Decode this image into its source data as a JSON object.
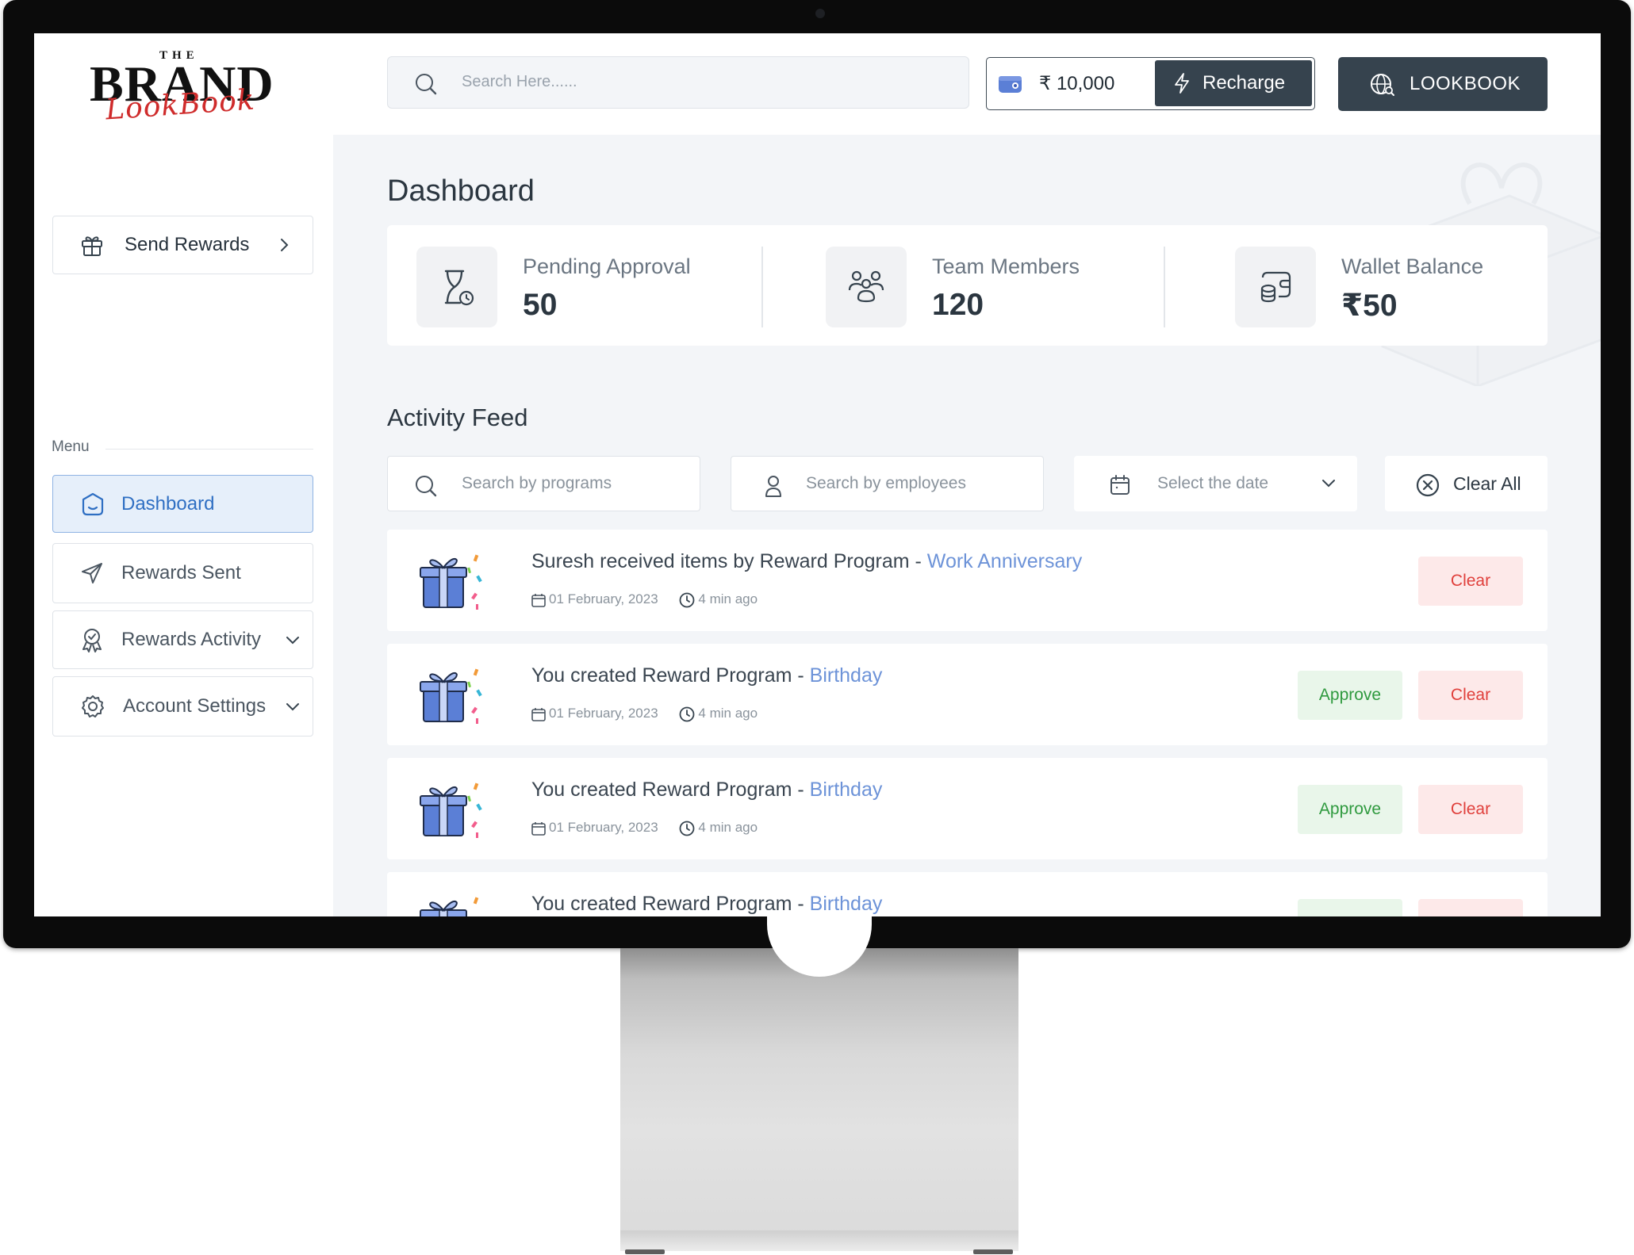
{
  "brand": {
    "the": "THE",
    "name": "BRAND",
    "script": "LookBook"
  },
  "search": {
    "placeholder": "Search Here......"
  },
  "wallet": {
    "amount": "₹ 10,000",
    "recharge_label": "Recharge"
  },
  "lookbook_label": "LOOKBOOK",
  "sidebar": {
    "send_rewards": "Send Rewards",
    "menu_label": "Menu",
    "items": [
      {
        "label": "Dashboard",
        "active": true
      },
      {
        "label": "Rewards Sent"
      },
      {
        "label": "Rewards Activity"
      },
      {
        "label": "Account Settings"
      }
    ]
  },
  "dashboard": {
    "title": "Dashboard",
    "stats": [
      {
        "label": "Pending Approval",
        "value": "50",
        "icon": "hourglass-icon"
      },
      {
        "label": "Team Members",
        "value": "120",
        "icon": "team-icon"
      },
      {
        "label": "Wallet Balance",
        "value": "₹50",
        "icon": "wallet-coins-icon"
      }
    ]
  },
  "activity": {
    "title": "Activity Feed",
    "filters": {
      "programs_placeholder": "Search by programs",
      "employees_placeholder": "Search by employees",
      "date_placeholder": "Select the date",
      "clear_all": "Clear All"
    },
    "items": [
      {
        "text": "Suresh received items by Reward Program - ",
        "program": "Work Anniversary",
        "date": "01 February, 2023",
        "time": "4 min ago",
        "approve": "",
        "clear": "Clear"
      },
      {
        "text": "You created Reward Program - ",
        "program": "Birthday",
        "date": "01 February, 2023",
        "time": "4 min ago",
        "approve": "Approve",
        "clear": "Clear"
      },
      {
        "text": "You created Reward Program - ",
        "program": "Birthday",
        "date": "01 February, 2023",
        "time": "4 min ago",
        "approve": "Approve",
        "clear": "Clear"
      },
      {
        "text": "You created Reward Program - ",
        "program": "Birthday",
        "date": "",
        "time": "",
        "approve": "",
        "clear": ""
      }
    ]
  },
  "colors": {
    "primary_dark": "#36434e",
    "accent_blue": "#2f6fc3",
    "approve_green": "#2f9a3f",
    "clear_red": "#e0403c"
  }
}
